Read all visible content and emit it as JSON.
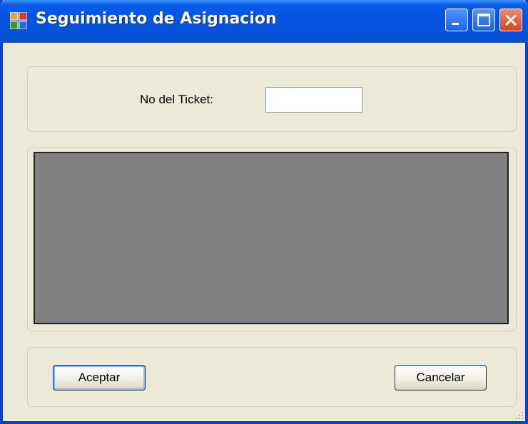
{
  "window": {
    "title": "Seguimiento de Asignacion",
    "controls": [
      "minimize",
      "maximize",
      "close"
    ]
  },
  "ticket": {
    "label": "No del Ticket:",
    "value": ""
  },
  "buttons": {
    "accept_label": "Aceptar",
    "cancel_label": "Cancelar"
  },
  "colors": {
    "titlebar": "#0552dd",
    "window_bg": "#ece9d8",
    "panel_bg": "#808080"
  }
}
